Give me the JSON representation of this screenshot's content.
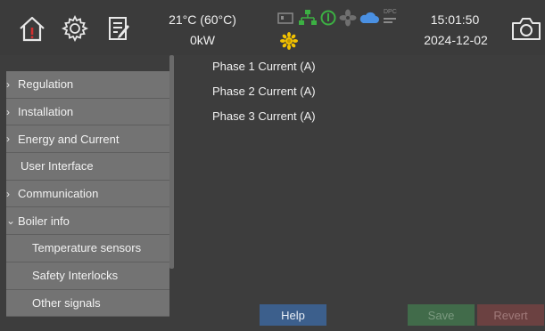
{
  "header": {
    "temperature": "21°C (60°C)",
    "power": "0kW",
    "time": "15:01:50",
    "date": "2024-12-02",
    "status_text": "DPC"
  },
  "icons": {
    "home": "home-alert-icon",
    "settings": "gear-icon",
    "notes": "notepad-icon",
    "camera": "camera-icon"
  },
  "colors": {
    "alert_red": "#d32f2f",
    "status_green": "#3cb043",
    "status_blue": "#4a90e2",
    "sun_yellow": "#f2c200"
  },
  "sidebar": {
    "items": [
      {
        "label": "Regulation",
        "chevron": "›"
      },
      {
        "label": "Installation",
        "chevron": "›"
      },
      {
        "label": "Energy and Current",
        "chevron": "›"
      },
      {
        "label": "User Interface",
        "chevron": ""
      },
      {
        "label": "Communication",
        "chevron": "›"
      },
      {
        "label": "Boiler info",
        "chevron": "⌄"
      },
      {
        "label": "Temperature sensors",
        "chevron": ""
      },
      {
        "label": "Safety Interlocks",
        "chevron": ""
      },
      {
        "label": "Other signals",
        "chevron": ""
      }
    ]
  },
  "content": {
    "params": [
      "Phase 1 Current (A)",
      "Phase 2 Current (A)",
      "Phase 3 Current (A)"
    ]
  },
  "buttons": {
    "help": "Help",
    "save": "Save",
    "revert": "Revert"
  }
}
